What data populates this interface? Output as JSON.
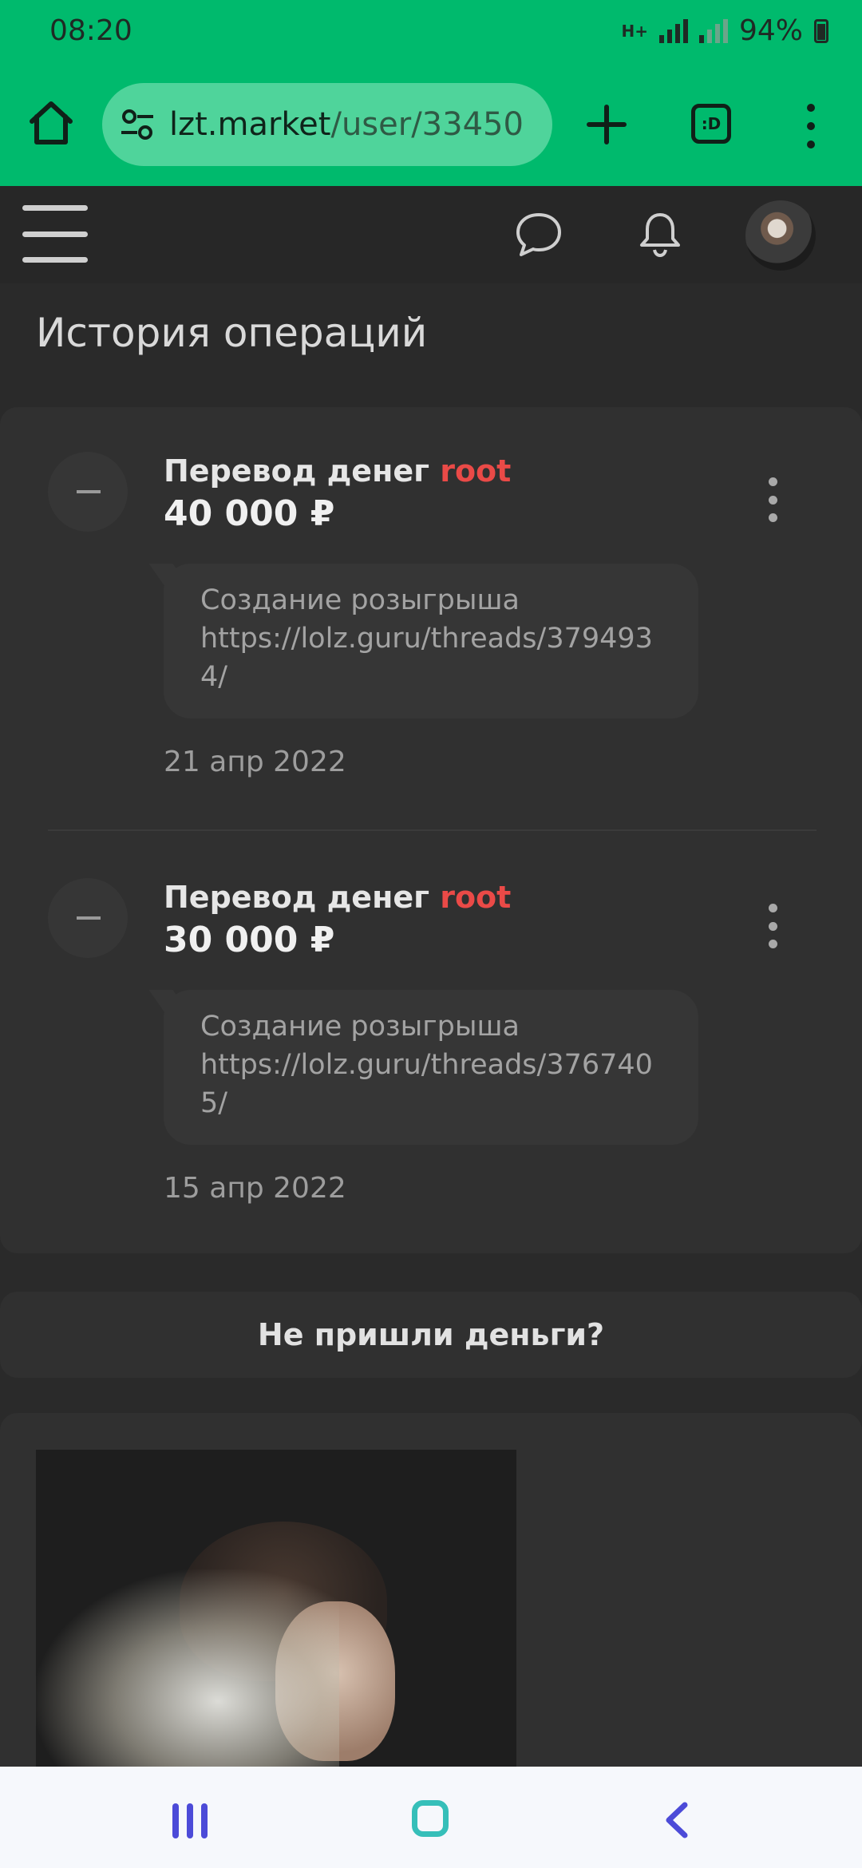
{
  "status_bar": {
    "time": "08:20",
    "network": "H+",
    "battery": "94%"
  },
  "browser": {
    "url_host": "lzt.market",
    "url_path": "/user/33450",
    "tabs_label": ":D"
  },
  "page": {
    "title": "История операций"
  },
  "operations": [
    {
      "title_prefix": "Перевод денег",
      "user": "root",
      "amount": "40 000 ₽",
      "note_line1": "Создание розыгрыша",
      "note_line2": "https://lolz.guru/threads/379493",
      "note_line3": "4/",
      "date": "21 апр 2022"
    },
    {
      "title_prefix": "Перевод денег",
      "user": "root",
      "amount": "30 000 ₽",
      "note_line1": "Создание розыгрыша",
      "note_line2": "https://lolz.guru/threads/376740",
      "note_line3": "5/",
      "date": "15 апр 2022"
    }
  ],
  "help": {
    "label": "Не пришли деньги?"
  },
  "colors": {
    "browser_green": "#00ba6d",
    "username_red": "#ea4a47",
    "background": "#2a2a2a"
  }
}
